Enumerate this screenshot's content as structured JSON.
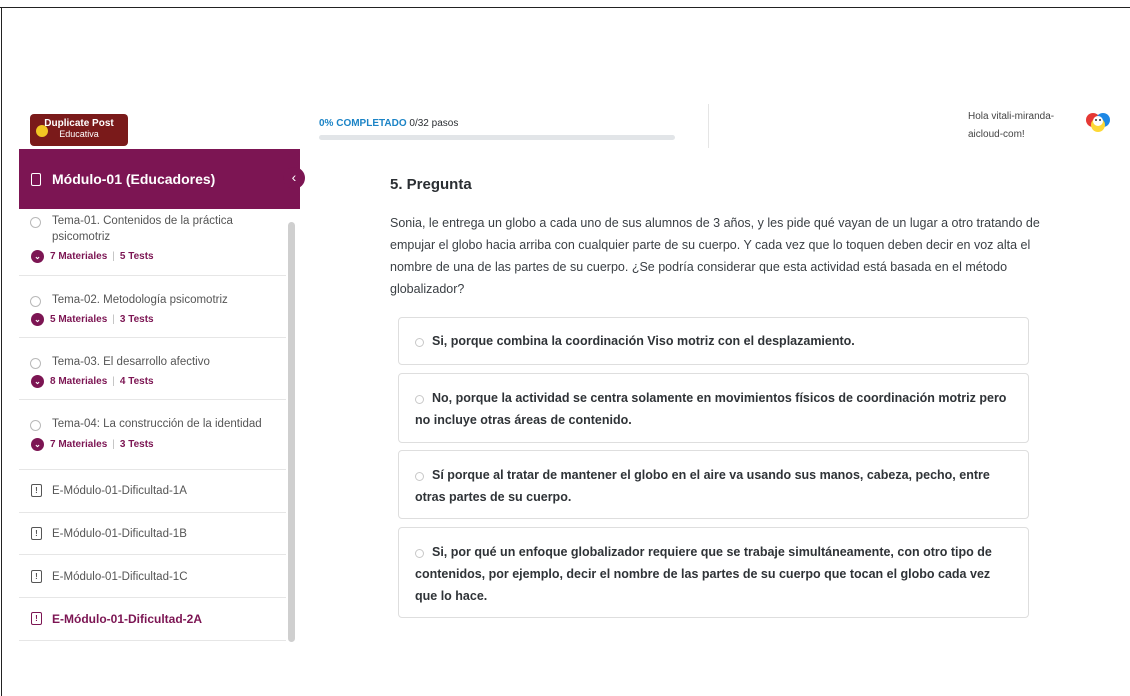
{
  "header": {
    "logo_line1": "Duplicate Post",
    "logo_line2": "Educativa",
    "progress_percent_label": "0% COMPLETADO",
    "progress_steps": "0/32 pasos",
    "progress_fraction": 0,
    "greeting": "Hola vitali-miranda-aicloud-com!"
  },
  "sidebar": {
    "module_title": "Módulo-01 (Educadores)",
    "collapse_icon": "chevron-left-icon",
    "topics": [
      {
        "name": "Tema-01. Contenidos de la práctica psicomotriz",
        "materials": "7 Materiales",
        "tests": "5 Tests"
      },
      {
        "name": "Tema-02. Metodología psicomotriz",
        "materials": "5 Materiales",
        "tests": "3 Tests"
      },
      {
        "name": "Tema-03. El desarrollo afectivo",
        "materials": "8 Materiales",
        "tests": "4 Tests"
      },
      {
        "name": "Tema-04: La construcción de la identidad",
        "materials": "7 Materiales",
        "tests": "3 Tests"
      }
    ],
    "exams": [
      {
        "name": "E-Módulo-01-Dificultad-1A",
        "active": false
      },
      {
        "name": "E-Módulo-01-Dificultad-1B",
        "active": false
      },
      {
        "name": "E-Módulo-01-Dificultad-1C",
        "active": false
      },
      {
        "name": "E-Módulo-01-Dificultad-2A",
        "active": true
      }
    ]
  },
  "question": {
    "title": "5. Pregunta",
    "text": "Sonia, le entrega un globo a cada uno de sus alumnos de 3 años, y les pide qué vayan de un lugar a otro tratando de empujar el globo hacia arriba con cualquier parte de su cuerpo. Y cada vez que lo toquen deben decir en voz alta el nombre de una de las partes de su cuerpo. ¿Se podría considerar que esta actividad está basada en el método globalizador?",
    "answers": [
      "Si, porque combina la coordinación Viso motriz con el desplazamiento.",
      "No, porque la actividad se centra solamente en movimientos físicos de coordinación motriz pero no incluye otras áreas de contenido.",
      "Sí porque al tratar de mantener el globo en el aire va usando sus manos, cabeza, pecho, entre otras partes de su cuerpo.",
      "Si, por qué un enfoque globalizador requiere que se trabaje simultáneamente, con otro tipo de contenidos, por ejemplo, decir el nombre de las partes de su cuerpo que tocan el globo cada vez que lo hace."
    ]
  },
  "colors": {
    "brand": "#7c1553",
    "progress_accent": "#1c84c6"
  }
}
